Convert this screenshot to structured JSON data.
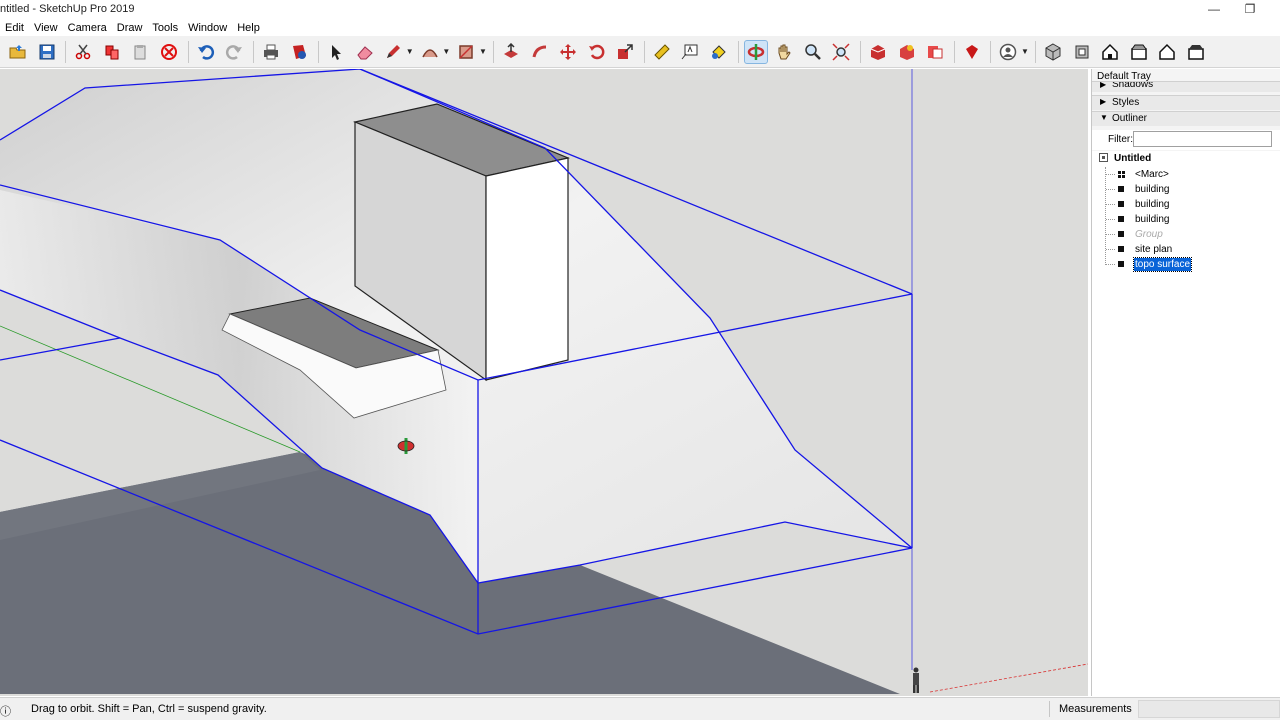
{
  "window": {
    "title": "ntitled - SketchUp Pro 2019",
    "minimize_glyph": "—",
    "restore_glyph": "❐"
  },
  "menu": {
    "items": [
      "Edit",
      "View",
      "Camera",
      "Draw",
      "Tools",
      "Window",
      "Help"
    ]
  },
  "toolbar": {
    "tools": [
      {
        "name": "open-icon"
      },
      {
        "name": "save-icon"
      },
      {
        "name": "cut-icon"
      },
      {
        "name": "copy-icon"
      },
      {
        "name": "paste-icon"
      },
      {
        "name": "erase-selection-icon"
      },
      {
        "name": "undo-icon"
      },
      {
        "name": "redo-icon"
      },
      {
        "name": "print-icon"
      },
      {
        "name": "model-info-icon"
      },
      {
        "name": "select-icon"
      },
      {
        "name": "eraser-icon"
      },
      {
        "name": "pencil-icon"
      },
      {
        "name": "arc-icon"
      },
      {
        "name": "rectangle-icon"
      },
      {
        "name": "push-pull-icon"
      },
      {
        "name": "follow-me-icon"
      },
      {
        "name": "move-icon"
      },
      {
        "name": "rotate-icon"
      },
      {
        "name": "scale-icon"
      },
      {
        "name": "tape-measure-icon"
      },
      {
        "name": "text-icon"
      },
      {
        "name": "paint-bucket-icon"
      },
      {
        "name": "orbit-icon",
        "active": true
      },
      {
        "name": "pan-icon"
      },
      {
        "name": "zoom-icon"
      },
      {
        "name": "zoom-extents-icon"
      },
      {
        "name": "warehouse-icon"
      },
      {
        "name": "extension-warehouse-icon"
      },
      {
        "name": "send-to-layout-icon"
      },
      {
        "name": "ruby-console-icon"
      },
      {
        "name": "account-icon"
      },
      {
        "name": "iso-view-icon"
      },
      {
        "name": "top-view-icon"
      },
      {
        "name": "front-view-icon"
      },
      {
        "name": "right-view-icon"
      },
      {
        "name": "back-view-icon"
      },
      {
        "name": "left-view-icon"
      }
    ]
  },
  "tray": {
    "title": "Default Tray",
    "sections": [
      {
        "label": "Shadows",
        "arrow": "▶"
      },
      {
        "label": "Styles",
        "arrow": "▶"
      },
      {
        "label": "Outliner",
        "arrow": "▼"
      }
    ],
    "filter_label": "Filter:",
    "filter_value": "",
    "outliner": {
      "root": "Untitled",
      "items": [
        {
          "label": "<Marc>",
          "kind": "component"
        },
        {
          "label": "building",
          "kind": "group"
        },
        {
          "label": "building",
          "kind": "group"
        },
        {
          "label": "building",
          "kind": "group"
        },
        {
          "label": "Group",
          "kind": "group",
          "hidden": true
        },
        {
          "label": "site plan",
          "kind": "group"
        },
        {
          "label": "topo surface",
          "kind": "group",
          "selected": true
        }
      ]
    }
  },
  "status": {
    "hint": "Drag to orbit. Shift = Pan, Ctrl = suspend gravity.",
    "measurements_label": "Measurements",
    "measurements_value": ""
  },
  "colors": {
    "selection_blue": "#1515e6",
    "ground_dark": "#6b6f79",
    "sky_background": "#dcdcda",
    "active_tool_bg": "#cfe4f7"
  }
}
